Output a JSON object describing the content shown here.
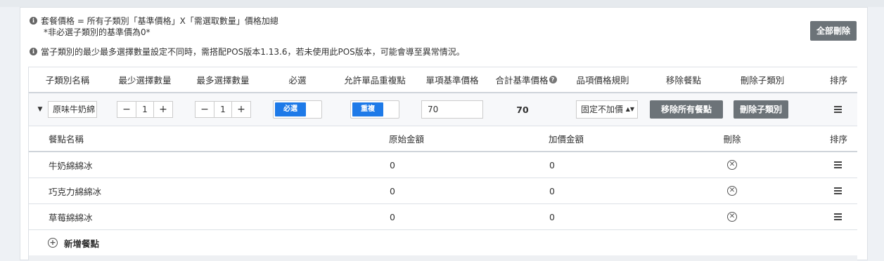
{
  "notes": {
    "formula": "套餐價格 = 所有子類別「基準價格」X「需選取數量」價格加總",
    "non_required": "*非必選子類別的基準價為0*",
    "version_warning": "當子類別的最少最多選擇數量設定不同時，需搭配POS版本1.13.6，若未使用此POS版本，可能會導至異常情況。"
  },
  "delete_all_label": "全部刪除",
  "subcategory_headers": [
    "子類別名稱",
    "最少選擇數量",
    "最多選擇數量",
    "必選",
    "允許單品重複點",
    "單項基準價格",
    "合計基準價格",
    "品項價格規則",
    "移除餐點",
    "刪除子類別",
    "排序"
  ],
  "subcategory": {
    "name": "原味牛奶綿",
    "min_qty": "1",
    "max_qty": "1",
    "required_label": "必選",
    "repeat_label": "重複",
    "unit_base_price": "70",
    "total_base_price": "70",
    "price_rule": "固定不加價",
    "remove_items_label": "移除所有餐點",
    "delete_subcategory_label": "刪除子類別"
  },
  "item_headers": {
    "name": "餐點名稱",
    "original": "原始金額",
    "extra": "加價金額",
    "delete": "刪除",
    "sort": "排序"
  },
  "items": [
    {
      "name": "牛奶綿綿冰",
      "original": "0",
      "extra": "0"
    },
    {
      "name": "巧克力綿綿冰",
      "original": "0",
      "extra": "0"
    },
    {
      "name": "草莓綿綿冰",
      "original": "0",
      "extra": "0"
    }
  ],
  "add_item_label": "新增餐點",
  "colors": {
    "accent": "#1e7ae8",
    "dark_button": "#6c7378"
  },
  "icons": {
    "info": "info-icon",
    "help": "question-icon",
    "sort": "sort-handle-icon",
    "delete": "circle-x-icon",
    "add": "circle-plus-icon",
    "expand": "caret-down-icon"
  }
}
